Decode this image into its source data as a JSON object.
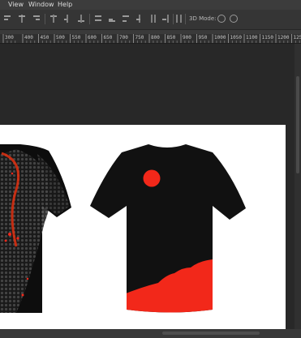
{
  "menu": {
    "items": [
      {
        "label": "View"
      },
      {
        "label": "Window"
      },
      {
        "label": "Help"
      }
    ]
  },
  "options_bar": {
    "mode_label": "3D Mode:"
  },
  "ruler": {
    "ticks": [
      "300",
      "400",
      "450",
      "500",
      "550",
      "600",
      "650",
      "700",
      "750",
      "800",
      "850",
      "900",
      "950",
      "1000",
      "1050",
      "1100",
      "1150",
      "1200",
      "1250"
    ]
  },
  "colors": {
    "shirt": "#111111",
    "accent": "#f2281a",
    "canvas": "#ffffff",
    "workspace": "#282828"
  }
}
